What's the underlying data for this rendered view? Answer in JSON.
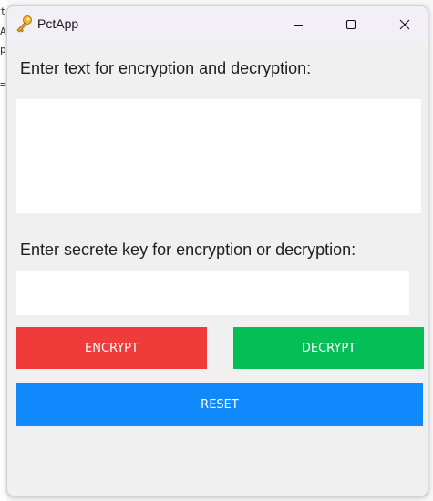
{
  "window": {
    "title": "PctApp",
    "icon": "key-icon",
    "controls": [
      "minimize-icon",
      "maximize-icon",
      "close-icon"
    ]
  },
  "background_glyphs": [
    "t",
    "A",
    "p",
    "="
  ],
  "main": {
    "text_label": "Enter text for encryption and decryption:",
    "text_value": "",
    "key_label": "Enter secrete key for encryption or decryption:",
    "key_value": ""
  },
  "buttons": {
    "encrypt": "ENCRYPT",
    "decrypt": "DECRYPT",
    "reset": "RESET"
  },
  "colors": {
    "encrypt": "#ef3b3a",
    "decrypt": "#04bf56",
    "reset": "#1089fd"
  }
}
